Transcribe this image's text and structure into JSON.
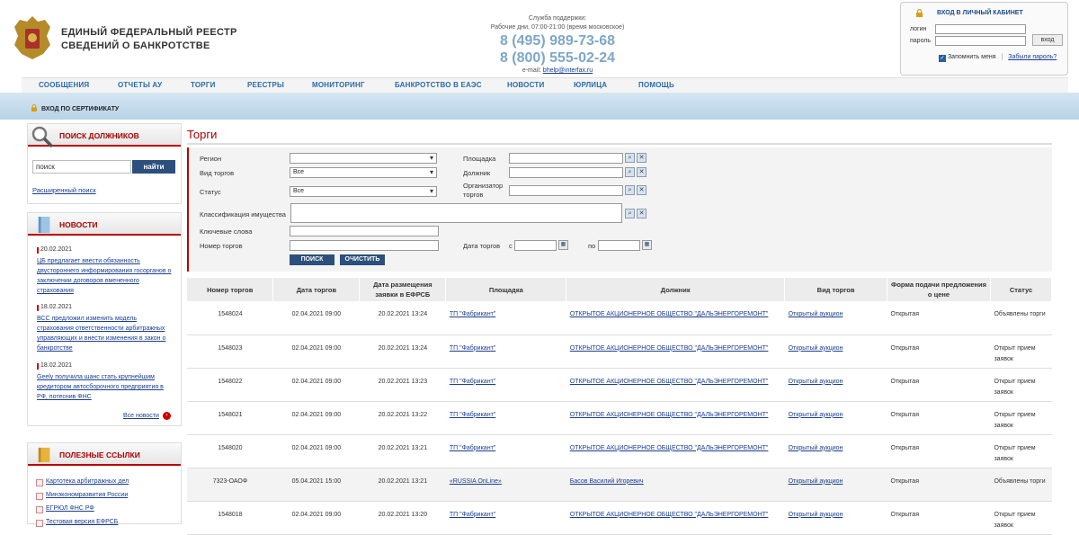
{
  "header": {
    "brand_line1": "ЕДИНЫЙ ФЕДЕРАЛЬНЫЙ РЕЕСТР",
    "brand_line2": "СВЕДЕНИЙ О БАНКРОТСТВЕ",
    "support_title": "Служба поддержки:",
    "support_hours": "Рабочие дни, 07:00-21:00 (время московское)",
    "phone1": "8 (495) 989-73-68",
    "phone2": "8 (800) 555-02-24",
    "email_label": "e-mail:",
    "email": "bhelp@interfax.ru"
  },
  "login": {
    "title": "ВХОД В ЛИЧНЫЙ КАБИНЕТ",
    "login_label": "логин",
    "password_label": "пароль",
    "submit_label": "вход",
    "remember_label": "Запомнить меня",
    "separator": "|",
    "forgot_label": "Забыли пароль?"
  },
  "nav": {
    "items": [
      "СООБЩЕНИЯ",
      "ОТЧЕТЫ АУ",
      "ТОРГИ",
      "РЕЕСТРЫ",
      "МОНИТОРИНГ",
      "БАНКРОТСТВО В ЕАЭС",
      "НОВОСТИ",
      "ЮРЛИЦА",
      "ПОМОЩЬ"
    ]
  },
  "cert": {
    "label": "ВХОД ПО СЕРТИФИКАТУ"
  },
  "debtor_search": {
    "title": "ПОИСК ДОЛЖНИКОВ",
    "input_value": "поиск",
    "button_label": "найти",
    "advanced_label": "Расширенный поиск"
  },
  "news": {
    "title": "НОВОСТИ",
    "items": [
      {
        "date": "20.02.2021",
        "text": "ЦБ предлагает ввести обязанность двустороннего информирования госорганов о заключении договоров вмененного страхования"
      },
      {
        "date": "18.02.2021",
        "text": "ВСС предложил изменить модель страхования ответственности арбитражных управляющих и внести изменения в закон о банкротстве"
      },
      {
        "date": "18.02.2021",
        "text": "Geely получила шанс стать крупнейшим кредитором автосборочного предприятия в РФ, потеснив ФНС"
      }
    ],
    "all_label": "Все новости"
  },
  "links": {
    "title": "ПОЛЕЗНЫЕ ССЫЛКИ",
    "items": [
      "Картотека арбитражных дел",
      "Минэкономразвития России",
      "ЕГРЮЛ ФНС РФ",
      "Тестовая версия ЕФРСБ"
    ]
  },
  "main": {
    "title": "Торги",
    "filters": {
      "region_label": "Регион",
      "region_value": "",
      "type_label": "Вид торгов",
      "type_value": "Все",
      "status_label": "Статус",
      "status_value": "Все",
      "property_label": "Классификация имущества",
      "keywords_label": "Ключевые слова",
      "number_label": "Номер торгов",
      "platform_label": "Площадка",
      "debtor_label": "Должник",
      "organizer_label": "Организатор торгов",
      "date_label": "Дата торгов",
      "from_label": "с",
      "to_label": "по",
      "search_button": "ПОИСК",
      "clear_button": "ОЧИСТИТЬ"
    },
    "table": {
      "headers": [
        "Номер торгов",
        "Дата торгов",
        "Дата размещения заявки в ЕФРСБ",
        "Площадка",
        "Должник",
        "Вид торгов",
        "Форма подачи предложения о цене",
        "Статус"
      ],
      "rows": [
        [
          "1548024",
          "02.04.2021 09:00",
          "20.02.2021 13:24",
          "ТП \"Фабрикант\"",
          "ОТКРЫТОЕ АКЦИОНЕРНОЕ ОБЩЕСТВО \"ДАЛЬЭНЕРГОРЕМОНТ\"",
          "Открытый аукцион",
          "Открытая",
          "Объявлены торги"
        ],
        [
          "1548023",
          "02.04.2021 09:00",
          "20.02.2021 13:24",
          "ТП \"Фабрикант\"",
          "ОТКРЫТОЕ АКЦИОНЕРНОЕ ОБЩЕСТВО \"ДАЛЬЭНЕРГОРЕМОНТ\"",
          "Открытый аукцион",
          "Открытая",
          "Открыт прием заявок"
        ],
        [
          "1548022",
          "02.04.2021 09:00",
          "20.02.2021 13:23",
          "ТП \"Фабрикант\"",
          "ОТКРЫТОЕ АКЦИОНЕРНОЕ ОБЩЕСТВО \"ДАЛЬЭНЕРГОРЕМОНТ\"",
          "Открытый аукцион",
          "Открытая",
          "Открыт прием заявок"
        ],
        [
          "1548021",
          "02.04.2021 09:00",
          "20.02.2021 13:22",
          "ТП \"Фабрикант\"",
          "ОТКРЫТОЕ АКЦИОНЕРНОЕ ОБЩЕСТВО \"ДАЛЬЭНЕРГОРЕМОНТ\"",
          "Открытый аукцион",
          "Открытая",
          "Открыт прием заявок"
        ],
        [
          "1548020",
          "02.04.2021 09:00",
          "20.02.2021 13:21",
          "ТП \"Фабрикант\"",
          "ОТКРЫТОЕ АКЦИОНЕРНОЕ ОБЩЕСТВО \"ДАЛЬЭНЕРГОРЕМОНТ\"",
          "Открытый аукцион",
          "Открытая",
          "Открыт прием заявок"
        ],
        [
          "7323-ОАОФ",
          "05.04.2021 15:00",
          "20.02.2021 13:21",
          "«RUSSIA OnLine»",
          "Басов Василий Игоревич",
          "Открытый аукцион",
          "Открытая",
          "Объявлены торги"
        ],
        [
          "1548018",
          "02.04.2021 09:00",
          "20.02.2021 13:20",
          "ТП \"Фабрикант\"",
          "ОТКРЫТОЕ АКЦИОНЕРНОЕ ОБЩЕСТВО \"ДАЛЬЭНЕРГОРЕМОНТ\"",
          "Открытый аукцион",
          "Открытая",
          "Открыт прием заявок"
        ]
      ]
    }
  }
}
